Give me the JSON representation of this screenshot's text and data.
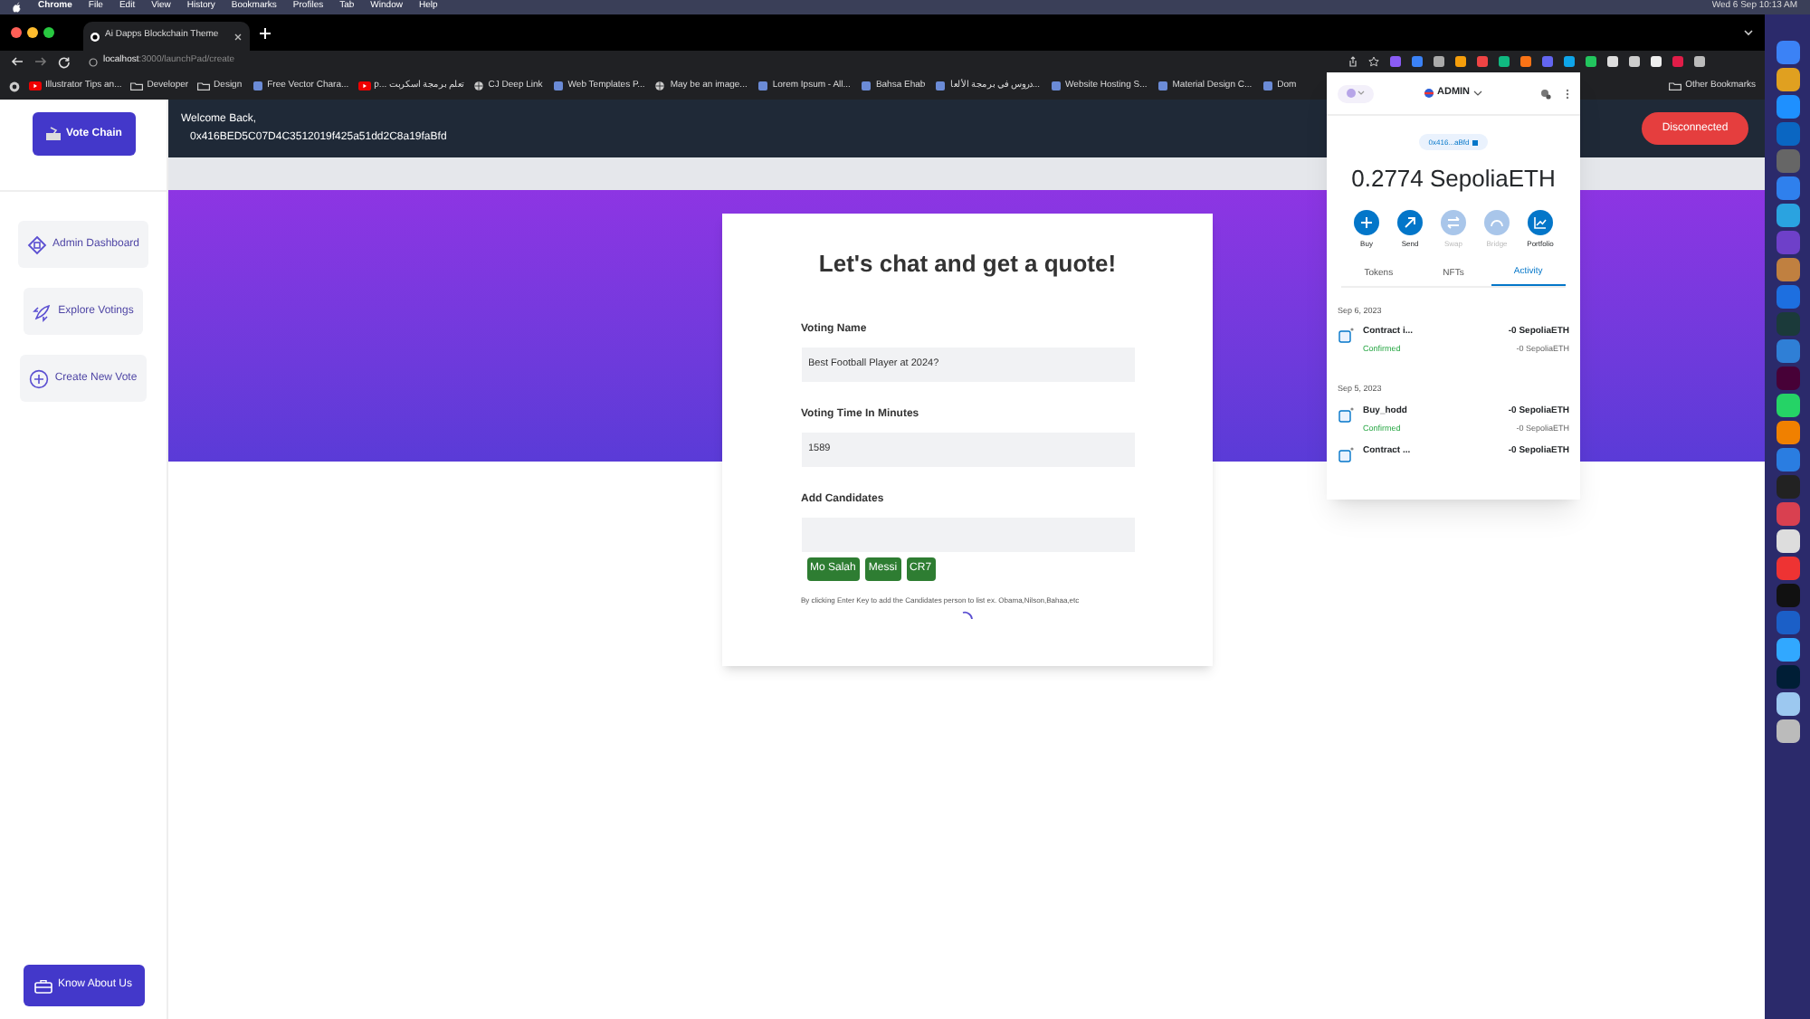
{
  "menubar": {
    "app": "Chrome",
    "items": [
      "File",
      "Edit",
      "View",
      "History",
      "Bookmarks",
      "Profiles",
      "Tab",
      "Window",
      "Help"
    ],
    "clock": "Wed 6 Sep  10:13 AM"
  },
  "browser": {
    "tab_title": "Ai Dapps Blockchain Theme",
    "url_host": "localhost",
    "url_path": ":3000/launchPad/create",
    "bookmarks": [
      {
        "label": "Illustrator Tips an...",
        "kind": "video"
      },
      {
        "label": "Developer",
        "kind": "folder"
      },
      {
        "label": "Design",
        "kind": "folder"
      },
      {
        "label": "Free Vector Chara...",
        "kind": "page"
      },
      {
        "label": "p... تعلم برمجة اسكربت",
        "kind": "video"
      },
      {
        "label": "CJ Deep Link",
        "kind": "globe"
      },
      {
        "label": "Web Templates P...",
        "kind": "page"
      },
      {
        "label": "May be an image...",
        "kind": "globe"
      },
      {
        "label": "Lorem Ipsum - All...",
        "kind": "page"
      },
      {
        "label": "Bahsa Ehab",
        "kind": "page"
      },
      {
        "label": "دروس في برمجة الألعا...",
        "kind": "page"
      },
      {
        "label": "Website Hosting S...",
        "kind": "page"
      },
      {
        "label": "Material Design C...",
        "kind": "page"
      },
      {
        "label": "Dom",
        "kind": "page"
      }
    ],
    "other_bookmarks": "Other Bookmarks"
  },
  "sidebar": {
    "brand": "Vote Chain",
    "items": [
      {
        "label": "Admin Dashboard",
        "kind": "dashboard",
        "selected": false
      },
      {
        "label": "Explore Votings",
        "kind": "rocket",
        "selected": false
      },
      {
        "label": "Create New Vote",
        "kind": "plus",
        "selected": false
      }
    ],
    "footer_button": "Know About Us"
  },
  "header": {
    "greeting": "Welcome Back,",
    "address": "0x416BED5C07D4C3512019f425a51dd2C8a19faBfd",
    "status_button": "Disconnected"
  },
  "form": {
    "title": "Let's chat and get a quote!",
    "fields": [
      {
        "label": "Voting Name",
        "value": "Best Football Player at 2024?"
      },
      {
        "label": "Voting Time In Minutes",
        "value": "1589"
      },
      {
        "label": "Add Candidates"
      }
    ],
    "candidates": [
      "Mo Salah",
      "Messi",
      "CR7"
    ],
    "hint": "By clicking Enter Key to add the Candidates person to list ex. Obama,Nilson,Bahaa,etc"
  },
  "wallet": {
    "account": "ADMIN",
    "address": "0x416...aBfd",
    "balance": "0.2774 SepoliaETH",
    "actions": [
      {
        "label": "Buy",
        "kind": "plus",
        "disabled": false
      },
      {
        "label": "Send",
        "kind": "arrow",
        "disabled": false
      },
      {
        "label": "Swap",
        "kind": "swap",
        "disabled": true
      },
      {
        "label": "Bridge",
        "kind": "bridge",
        "disabled": true
      },
      {
        "label": "Portfolio",
        "kind": "chart",
        "disabled": false
      }
    ],
    "tabs": [
      {
        "label": "Tokens",
        "selected": false
      },
      {
        "label": "NFTs",
        "selected": false
      },
      {
        "label": "Activity",
        "selected": true
      }
    ],
    "groups": [
      {
        "date": "Sep 6, 2023",
        "items": [
          {
            "title": "Contract i...",
            "status": "Confirmed",
            "amount": "-0 SepoliaETH",
            "sub_amount": "-0 SepoliaETH"
          }
        ]
      },
      {
        "date": "Sep 5, 2023",
        "items": [
          {
            "title": "Buy_hodd",
            "status": "Confirmed",
            "amount": "-0 SepoliaETH",
            "sub_amount": "-0 SepoliaETH"
          },
          {
            "title": "Contract ...",
            "amount": "-0 SepoliaETH"
          }
        ]
      }
    ]
  }
}
